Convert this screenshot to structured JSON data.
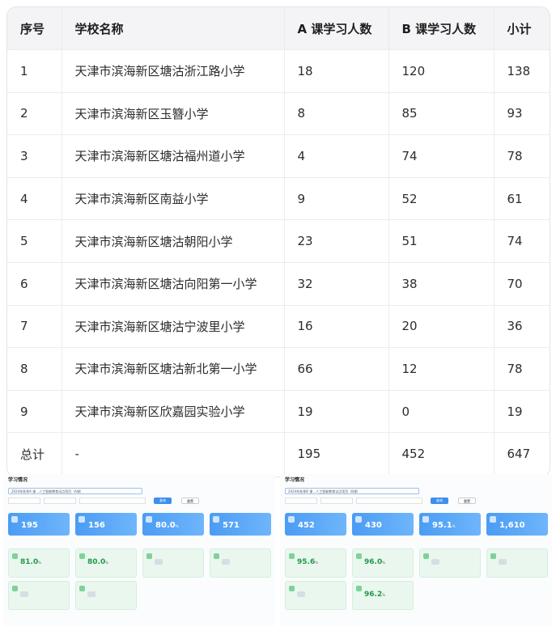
{
  "table": {
    "headers": [
      "序号",
      "学校名称",
      "A 课学习人数",
      "B 课学习人数",
      "小计"
    ],
    "rows": [
      [
        "1",
        "天津市滨海新区塘沽浙江路小学",
        "18",
        "120",
        "138"
      ],
      [
        "2",
        "天津市滨海新区玉簪小学",
        "8",
        "85",
        "93"
      ],
      [
        "3",
        "天津市滨海新区塘沽福州道小学",
        "4",
        "74",
        "78"
      ],
      [
        "4",
        "天津市滨海新区南益小学",
        "9",
        "52",
        "61"
      ],
      [
        "5",
        "天津市滨海新区塘沽朝阳小学",
        "23",
        "51",
        "74"
      ],
      [
        "6",
        "天津市滨海新区塘沽向阳第一小学",
        "32",
        "38",
        "70"
      ],
      [
        "7",
        "天津市滨海新区塘沽宁波里小学",
        "16",
        "20",
        "36"
      ],
      [
        "8",
        "天津市滨海新区塘沽新北第一小学",
        "66",
        "12",
        "78"
      ],
      [
        "9",
        "天津市滨海新区欣嘉园实验小学",
        "19",
        "0",
        "19"
      ],
      [
        "总计",
        "-",
        "195",
        "452",
        "647"
      ]
    ]
  },
  "mini_left": {
    "title": "学习情况",
    "course_select": "2024年秋季A 课…人工智能教育试点项目（A课）",
    "query_label": "查询",
    "reset_label": "重置",
    "stats": [
      "195",
      "156",
      "80.0",
      "571"
    ],
    "stat_units": [
      "",
      "",
      "%",
      ""
    ],
    "rates": [
      "81.0",
      "80.0"
    ],
    "rate_unit": "%"
  },
  "mini_right": {
    "title": "学习情况",
    "course_select": "2024年秋季B 课…人工智能教育试点项目（B课）",
    "query_label": "查询",
    "reset_label": "重置",
    "stats": [
      "452",
      "430",
      "95.1",
      "1,610"
    ],
    "stat_units": [
      "",
      "",
      "%",
      ""
    ],
    "rates": [
      "95.6",
      "96.0",
      "96.2"
    ],
    "rate_unit": "%"
  },
  "colors": {
    "header_bg": "#f4f4f6",
    "accent_blue": "#3d8ef0",
    "rate_green": "#1f9a4a"
  }
}
